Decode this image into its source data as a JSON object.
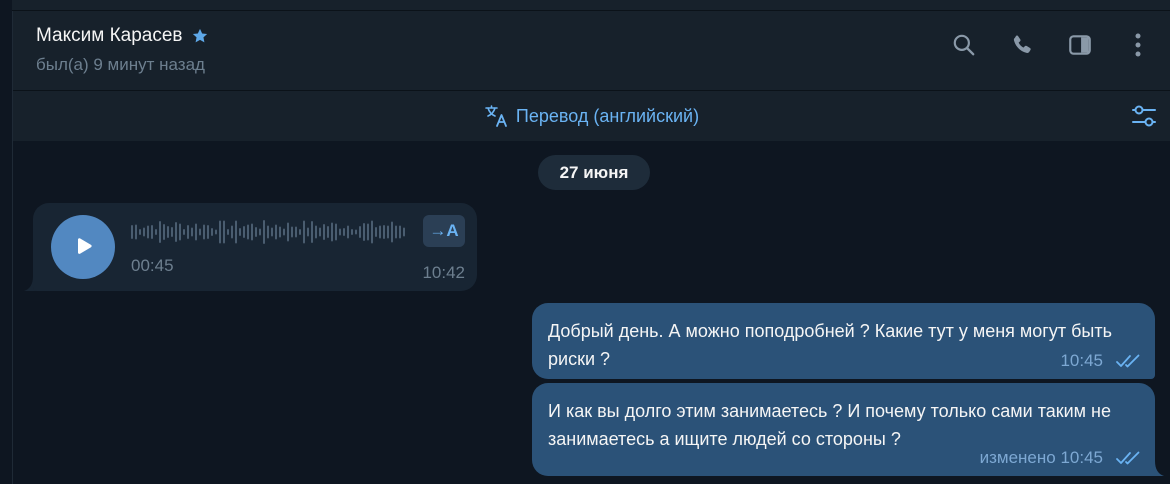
{
  "header": {
    "name": "Максим Карасев",
    "status": "был(а) 9 минут назад",
    "icons": [
      "star-icon",
      "search-icon",
      "phone-icon",
      "sidebar-toggle-icon",
      "more-vertical-icon"
    ]
  },
  "translate_bar": {
    "label": "Перевод (английский)",
    "icons": [
      "translate-icon",
      "settings-sliders-icon"
    ]
  },
  "date_separator": "27 июня",
  "messages": [
    {
      "type": "voice",
      "direction": "incoming",
      "duration": "00:45",
      "transcribe_label": "→A",
      "time": "10:42"
    },
    {
      "type": "text",
      "direction": "outgoing",
      "text": "Добрый день. А можно поподробней ? Какие тут у меня могут быть риски ?",
      "edited": "",
      "time": "10:45",
      "status_icon": "double-check-icon"
    },
    {
      "type": "text",
      "direction": "outgoing",
      "text": "И как вы долго этим занимаетесь ? И почему только сами таким не занимаетесь а ищите людей со стороны ?",
      "edited": "изменено",
      "time": "10:45",
      "status_icon": "double-check-icon"
    }
  ],
  "colors": {
    "background": "#0e1621",
    "header": "#17212b",
    "incoming_bubble": "#182533",
    "outgoing_bubble": "#2b5278",
    "accent": "#6ab3f3",
    "play_button": "#5288c1",
    "muted_text": "#6d7f8f"
  }
}
